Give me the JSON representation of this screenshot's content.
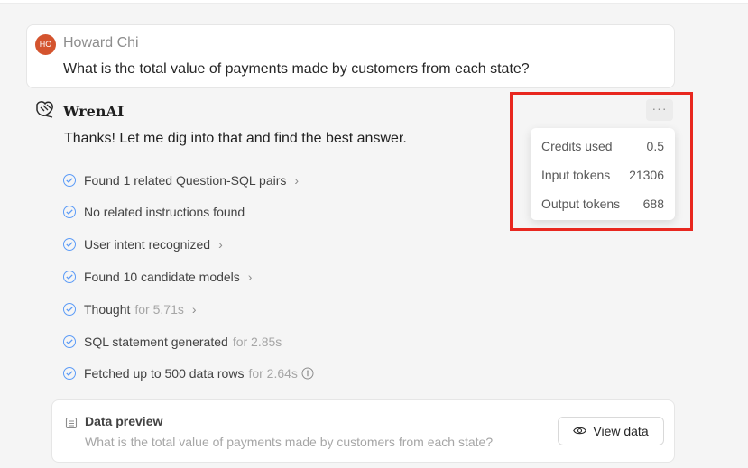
{
  "question": {
    "avatar_initials": "HO",
    "user_name": "Howard Chi",
    "text": "What is the total value of payments made by customers from each state?"
  },
  "answer": {
    "brand": "WrenAI",
    "more_label": "···",
    "intro": "Thanks! Let me dig into that and find the best answer.",
    "steps": [
      {
        "label": "Found 1 related Question-SQL pairs",
        "time": "",
        "chevron": true,
        "info": false
      },
      {
        "label": "No related instructions found",
        "time": "",
        "chevron": false,
        "info": false
      },
      {
        "label": "User intent recognized",
        "time": "",
        "chevron": true,
        "info": false
      },
      {
        "label": "Found 10 candidate models",
        "time": "",
        "chevron": true,
        "info": false
      },
      {
        "label": "Thought",
        "time": "for 5.71s",
        "chevron": true,
        "info": false
      },
      {
        "label": "SQL statement generated",
        "time": "for 2.85s",
        "chevron": false,
        "info": false
      },
      {
        "label": "Fetched up to 500 data rows",
        "time": "for 2.64s",
        "chevron": false,
        "info": true
      }
    ],
    "chevron_glyph": "›",
    "info_glyph": "i"
  },
  "data_preview": {
    "title": "Data preview",
    "question": "What is the total value of payments made by customers from each state?",
    "view_button": "View data"
  },
  "usage_popup": {
    "rows": [
      {
        "label": "Credits used",
        "value": "0.5"
      },
      {
        "label": "Input tokens",
        "value": "21306"
      },
      {
        "label": "Output tokens",
        "value": "688"
      }
    ]
  },
  "colors": {
    "accent_blue": "#5b9bf7",
    "avatar_bg": "#d4542e",
    "highlight_red": "#e8271f"
  }
}
